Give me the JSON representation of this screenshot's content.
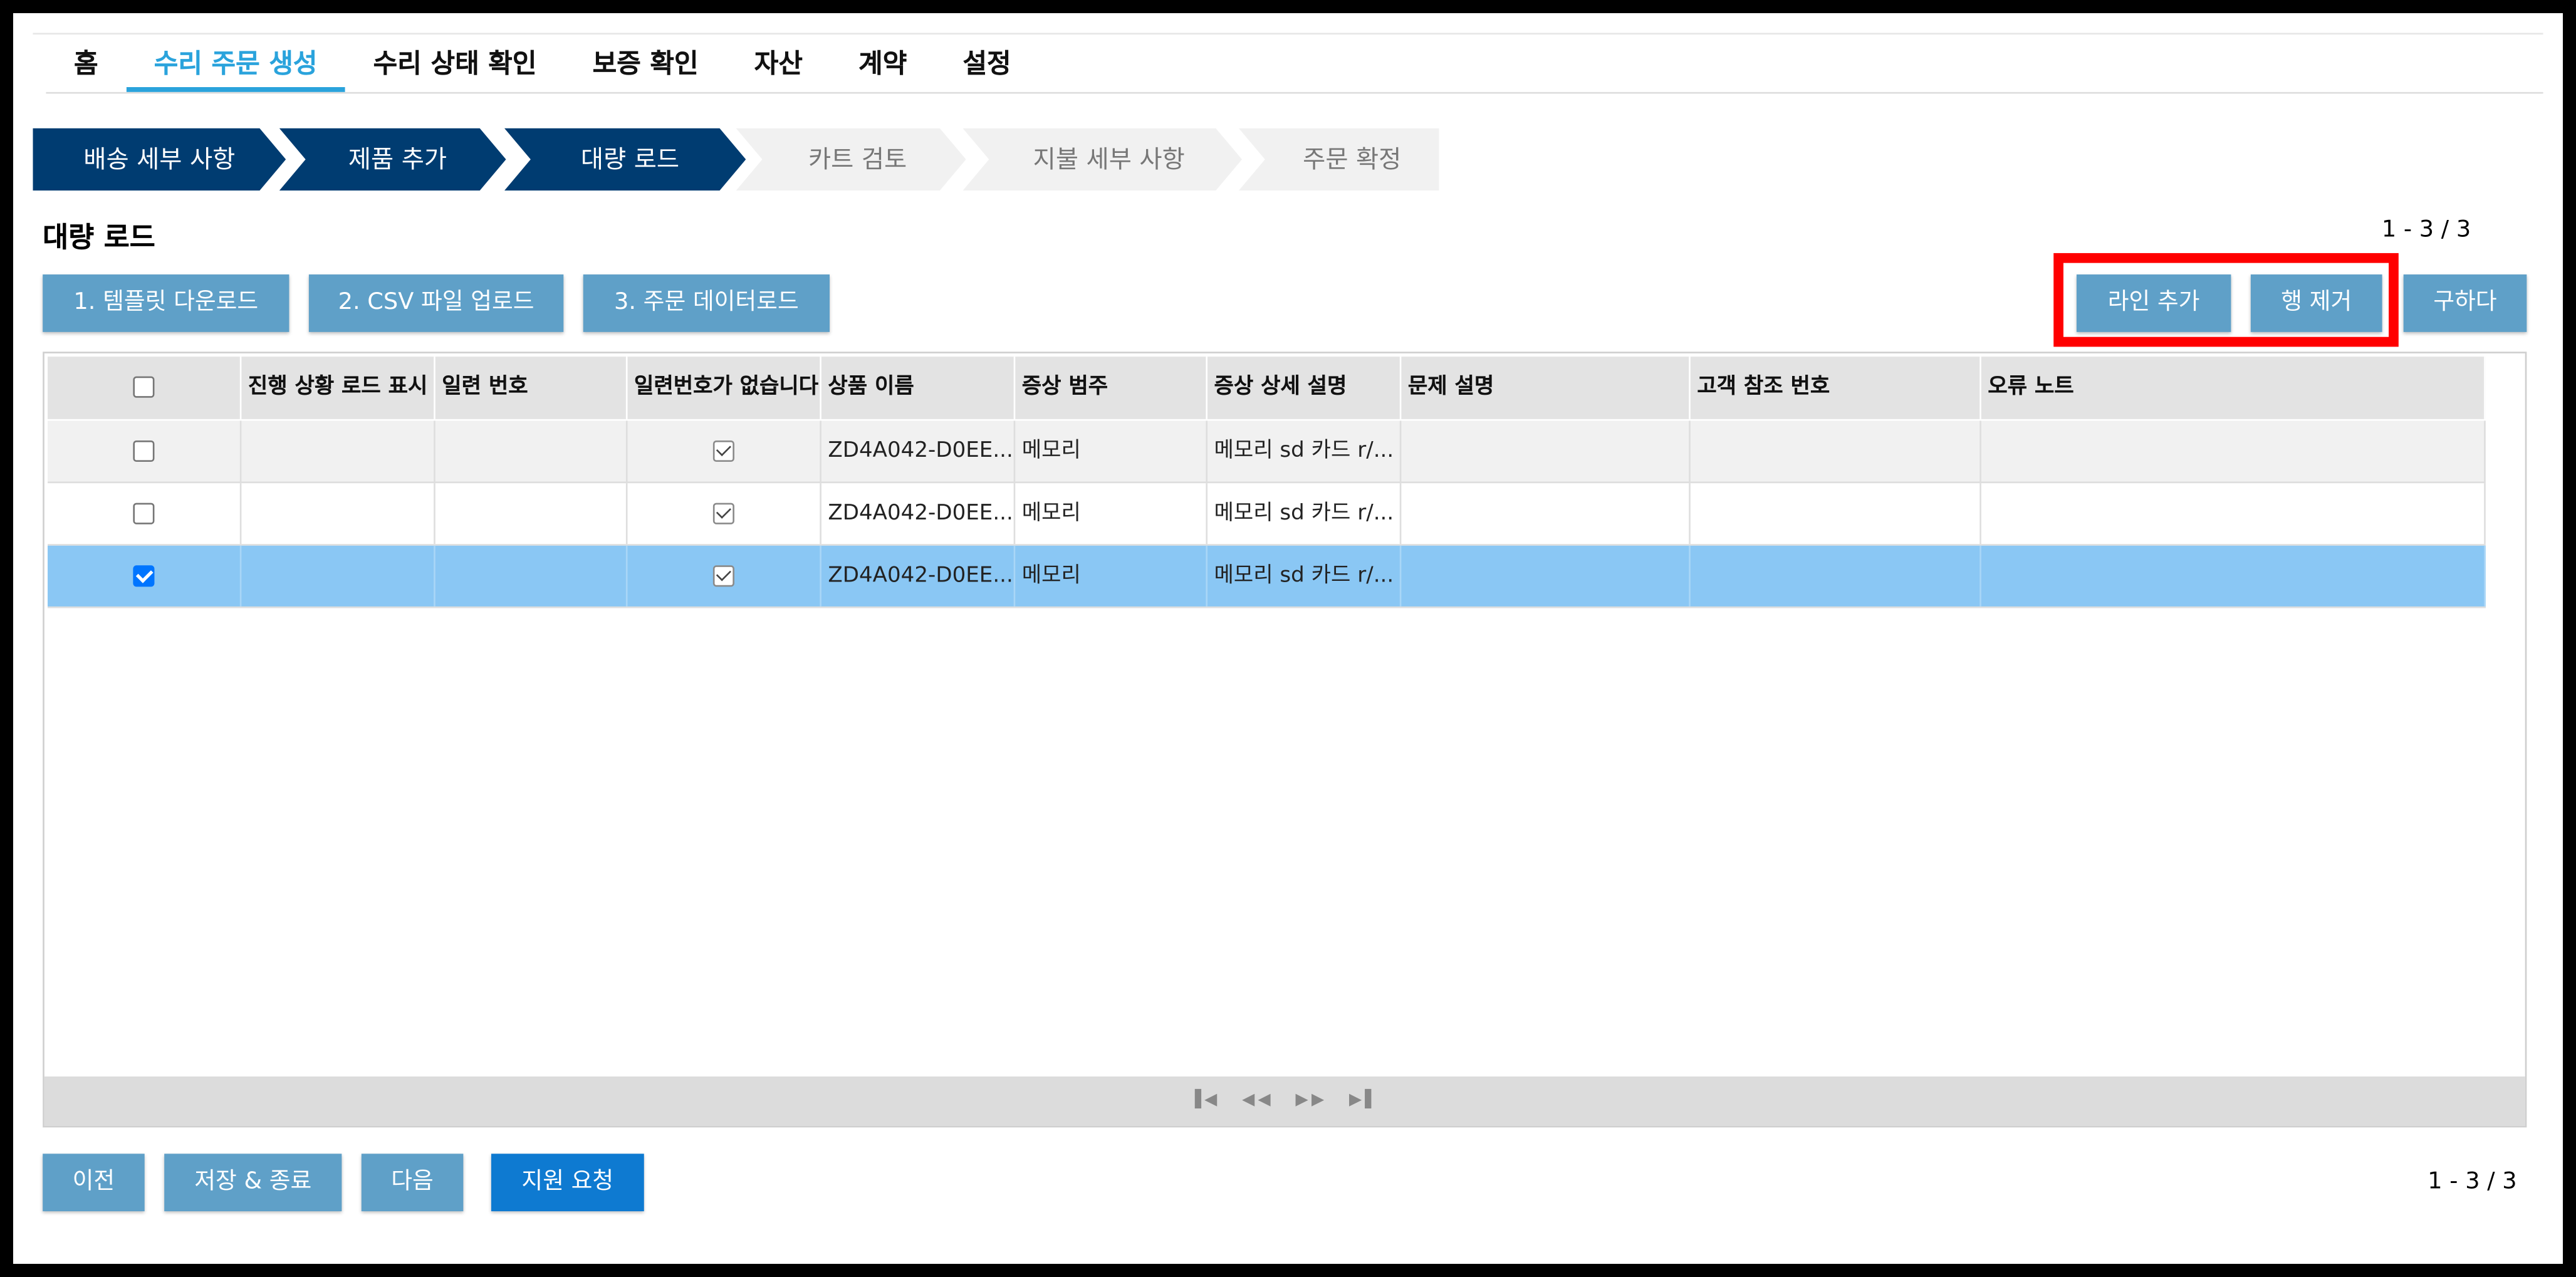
{
  "nav": {
    "home": "홈",
    "create_repair_order": "수리 주문 생성",
    "repair_status": "수리 상태 확인",
    "warranty_check": "보증 확인",
    "assets": "자산",
    "contracts": "계약",
    "settings": "설정"
  },
  "steps": [
    {
      "label": "배송 세부 사항",
      "state": "done"
    },
    {
      "label": "제품 추가",
      "state": "done"
    },
    {
      "label": "대량 로드",
      "state": "current"
    },
    {
      "label": "카트 검토",
      "state": "todo"
    },
    {
      "label": "지불 세부 사항",
      "state": "todo"
    },
    {
      "label": "주문 확정",
      "state": "todo"
    }
  ],
  "section_title": "대량 로드",
  "record_count": "1 - 3 / 3",
  "actions": {
    "download_template": "1. 템플릿 다운로드",
    "upload_csv": "2. CSV 파일 업로드",
    "load_order_data": "3. 주문 데이터로드",
    "add_line": "라인 추가",
    "remove_row": "행 제거",
    "save": "구하다"
  },
  "grid": {
    "columns": [
      "",
      "진행 상황 로드 표시",
      "일련 번호",
      "일련번호가 없습니다",
      "상품 이름",
      "증상 범주",
      "증상 상세 설명",
      "문제 설명",
      "고객 참조 번호",
      "오류 노트"
    ],
    "rows": [
      {
        "selected": false,
        "progress": "",
        "serial": "",
        "no_serial": true,
        "product": "ZD4A042-D0EE...",
        "symptom_category": "메모리",
        "symptom_detail": "메모리 sd 카드 r/...",
        "problem": "",
        "customer_ref": "",
        "error_note": ""
      },
      {
        "selected": false,
        "progress": "",
        "serial": "",
        "no_serial": true,
        "product": "ZD4A042-D0EE...",
        "symptom_category": "메모리",
        "symptom_detail": "메모리 sd 카드 r/...",
        "problem": "",
        "customer_ref": "",
        "error_note": ""
      },
      {
        "selected": true,
        "progress": "",
        "serial": "",
        "no_serial": true,
        "product": "ZD4A042-D0EE...",
        "symptom_category": "메모리",
        "symptom_detail": "메모리 sd 카드 r/...",
        "problem": "",
        "customer_ref": "",
        "error_note": ""
      }
    ],
    "pager_icons": [
      "first-page-icon",
      "prev-page-icon",
      "next-page-icon",
      "last-page-icon"
    ]
  },
  "footer": {
    "prev": "이전",
    "save_exit": "저장 & 종료",
    "next": "다음",
    "support": "지원 요청"
  },
  "colors": {
    "accent": "#2aa3dc",
    "step_done": "#003c71",
    "button": "#5fa0c8",
    "primary_button": "#0e7ad1",
    "selected_row": "#8ac7f4",
    "highlight": "#ff0000"
  }
}
